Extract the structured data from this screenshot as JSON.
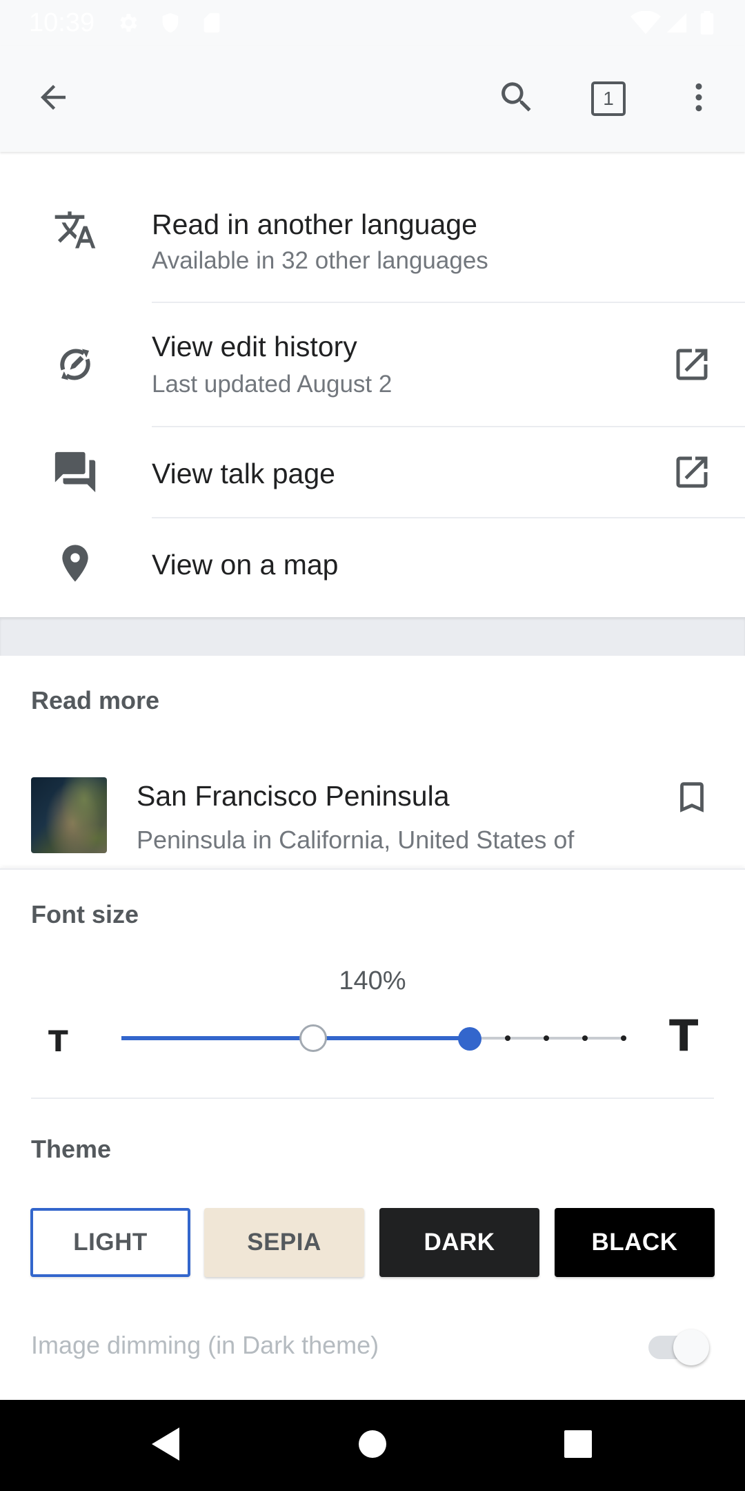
{
  "status_bar": {
    "time": "10:39",
    "icons": [
      "settings-icon",
      "shield-icon",
      "sd-card-icon",
      "wifi-icon",
      "signal-icon",
      "battery-icon"
    ]
  },
  "toolbar": {
    "tab_count": "1",
    "icons": [
      "back-arrow-icon",
      "search-icon",
      "tabs-icon",
      "more-vert-icon"
    ]
  },
  "menu": {
    "items": [
      {
        "title": "Read in another language",
        "subtitle": "Available in 32 other languages",
        "icon": "translate-icon"
      },
      {
        "title": "View edit history",
        "subtitle": "Last updated August 2",
        "icon": "edit-history-icon",
        "external": true
      },
      {
        "title": "View talk page",
        "subtitle": "",
        "icon": "talk-icon",
        "external": true
      },
      {
        "title": "View on a map",
        "subtitle": "",
        "icon": "map-pin-icon"
      }
    ]
  },
  "read_more": {
    "header": "Read more",
    "article": {
      "title": "San Francisco Peninsula",
      "description": "Peninsula in California, United States of",
      "icon": "bookmark-icon"
    }
  },
  "sheet": {
    "font_size": {
      "label": "Font size",
      "value": "140%",
      "small_icon": "T",
      "large_icon": "T",
      "slider_level": 0.69
    },
    "theme": {
      "label": "Theme",
      "options": [
        "LIGHT",
        "SEPIA",
        "DARK",
        "BLACK"
      ],
      "selected": "LIGHT"
    },
    "dimming": {
      "label": "Image dimming (in Dark theme)",
      "enabled": false
    }
  },
  "nav_bar": {
    "icons": [
      "back-triangle-icon",
      "home-circle-icon",
      "recents-square-icon"
    ]
  },
  "colors": {
    "accent": "#3366cc",
    "toolbar_bg": "#f8f9fa",
    "sepia": "#f0e6d6",
    "dark": "#202122",
    "black": "#000000"
  }
}
